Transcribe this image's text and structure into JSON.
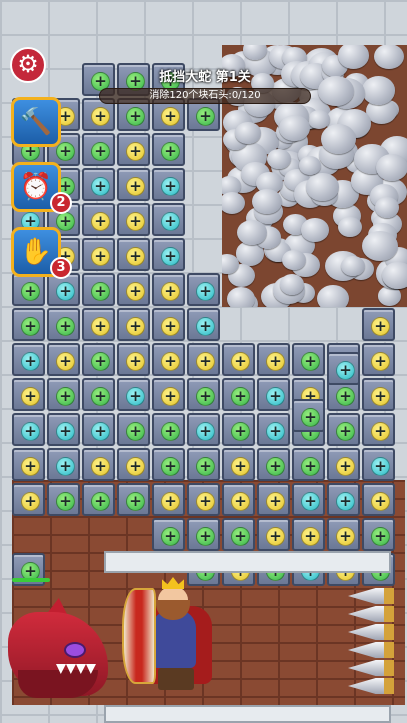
{
  "level": {
    "title": "抵挡大蛇 第1关",
    "goal_text": "消除120个块石头:",
    "progress_text": "0/120",
    "progress_fraction": 0
  },
  "toolbar": {
    "settings_icon": "gear-icon",
    "hammer": {
      "icon": "hammer-icon"
    },
    "clock": {
      "icon": "alarm-clock-icon",
      "count": "2"
    },
    "glove": {
      "icon": "glove-hand-icon",
      "count": "3"
    }
  },
  "board": {
    "rows": [
      "..ggg.....",
      "gyygyg....",
      "gggyg.....",
      "ggcyc.....",
      "cgyyc.....",
      "cyyyc.....",
      "gcgyyc.....",
      "ggyyyc....y",
      "cygyyyyyggy",
      "yggcyggcygy",
      "cccggcgcggy",
      "ycyyggyggyc",
      "ygggyyyyccy",
      "....gggyyyg",
      "g....gygcyg"
    ],
    "floating_tiles": [
      "g",
      "c"
    ]
  },
  "colors": {
    "screw_green": "#35b34a",
    "screw_cyan": "#27b8c2",
    "screw_yellow": "#e3c42a",
    "settings_red": "#c4283a",
    "tool_border": "#f3b11d",
    "badge_red": "#c9272f"
  },
  "characters": {
    "hero": "king-with-shield",
    "enemy": "red-dragon-head",
    "hazard": "wall-spikes"
  }
}
